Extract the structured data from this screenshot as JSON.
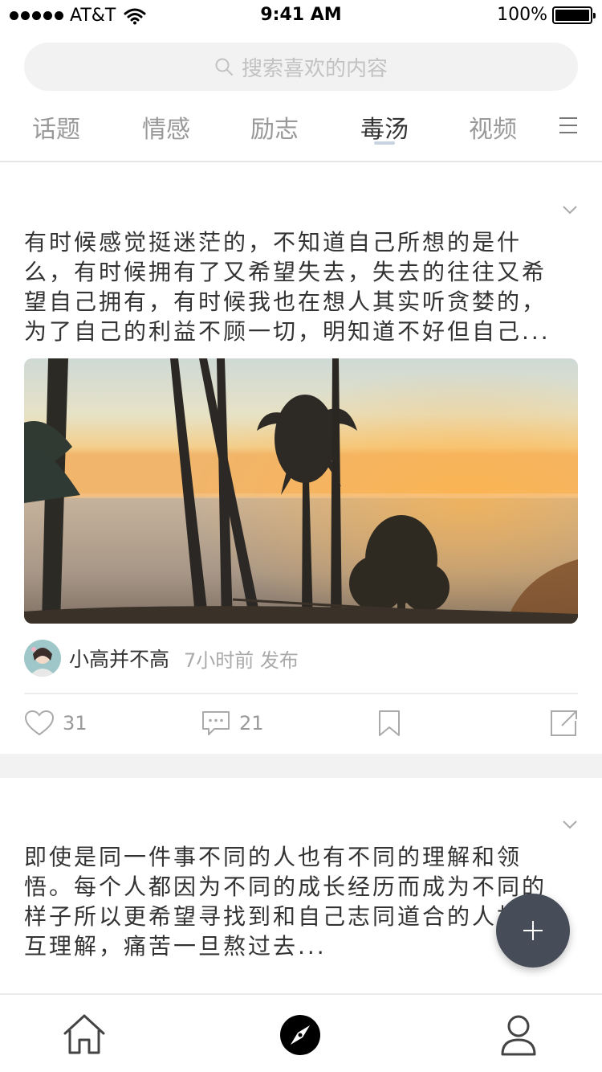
{
  "status_bar": {
    "carrier": "AT&T",
    "time": "9:41 AM",
    "battery": "100%"
  },
  "search": {
    "placeholder": "搜索喜欢的内容",
    "icon": "search-icon"
  },
  "tabs": [
    {
      "label": "话题",
      "active": false
    },
    {
      "label": "情感",
      "active": false
    },
    {
      "label": "励志",
      "active": false
    },
    {
      "label": "毒汤",
      "active": true
    },
    {
      "label": "视频",
      "active": false
    }
  ],
  "posts": [
    {
      "text_lines": [
        "有时候感觉挺迷茫的，不知道自己所想的是什",
        "么，有时候拥有了又希望失去，失去的往往又希",
        "望自己拥有，有时候我也在想人其实听贪婪的，",
        "为了自己的利益不顾一切，明知道不好但自己..."
      ],
      "author": "小高并不高",
      "time": "7小时前 发布",
      "likes": "31",
      "comments": "21"
    },
    {
      "text_lines": [
        "即使是同一件事不同的人也有不同的理解和领",
        "悟。每个人都因为不同的成长经历而成为不同的",
        "样子所以更希望寻找到和自己志同道合的人相",
        "互理解，痛苦一旦熬过去..."
      ]
    }
  ],
  "colors": {
    "accent": "#464c58",
    "muted": "#999999",
    "divider": "#ececec"
  }
}
